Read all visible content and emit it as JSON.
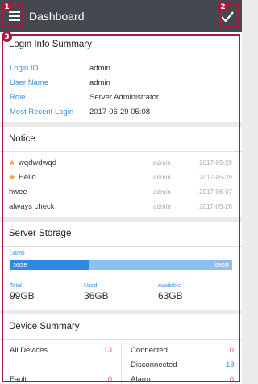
{
  "appbar": {
    "title": "Dashboard",
    "menu_icon": "hamburger-menu-icon",
    "confirm_icon": "checkmark-icon"
  },
  "callouts": [
    "1",
    "2",
    "3"
  ],
  "login_info": {
    "title": "Login Info Summary",
    "rows": [
      {
        "label": "Login ID",
        "value": "admin"
      },
      {
        "label": "User Name",
        "value": "admin"
      },
      {
        "label": "Role",
        "value": "Server Administrator"
      },
      {
        "label": "Most Recent Login",
        "value": "2017-06-29 05:08"
      }
    ]
  },
  "notice": {
    "title": "Notice",
    "rows": [
      {
        "starred": true,
        "title": "wqdwdwqd",
        "author": "admin",
        "date": "2017-05-29"
      },
      {
        "starred": true,
        "title": "Hello",
        "author": "admin",
        "date": "2017-05-29"
      },
      {
        "starred": false,
        "title": "hwee",
        "author": "admin",
        "date": "2017-06-07"
      },
      {
        "starred": false,
        "title": "always check",
        "author": "admin",
        "date": "2017-05-26"
      }
    ]
  },
  "storage": {
    "title": "Server Storage",
    "percent_label": "(36%)",
    "used_fraction": 0.36,
    "used_bar_label": "36GB",
    "total_bar_label": "63GB",
    "stats": [
      {
        "label": "Total",
        "value": "99GB"
      },
      {
        "label": "Used",
        "value": "36GB"
      },
      {
        "label": "Available",
        "value": "63GB"
      }
    ]
  },
  "device": {
    "title": "Device Summary",
    "rows": [
      {
        "left": {
          "name": "All Devices",
          "count": "13"
        },
        "right": {
          "name": "Connected",
          "count": "0"
        }
      },
      {
        "left": {
          "name": "",
          "count": ""
        },
        "right": {
          "name": "Disconnected",
          "count": "13"
        }
      },
      {
        "left": {
          "name": "Fault",
          "count": "0"
        },
        "right": {
          "name": "Alarm",
          "count": "0"
        }
      }
    ]
  },
  "colors": {
    "appbar": "#444950",
    "accent": "#3a8fd6",
    "callout": "#a51c3e",
    "star": "#f0a640",
    "count_red": "#e0615a"
  }
}
